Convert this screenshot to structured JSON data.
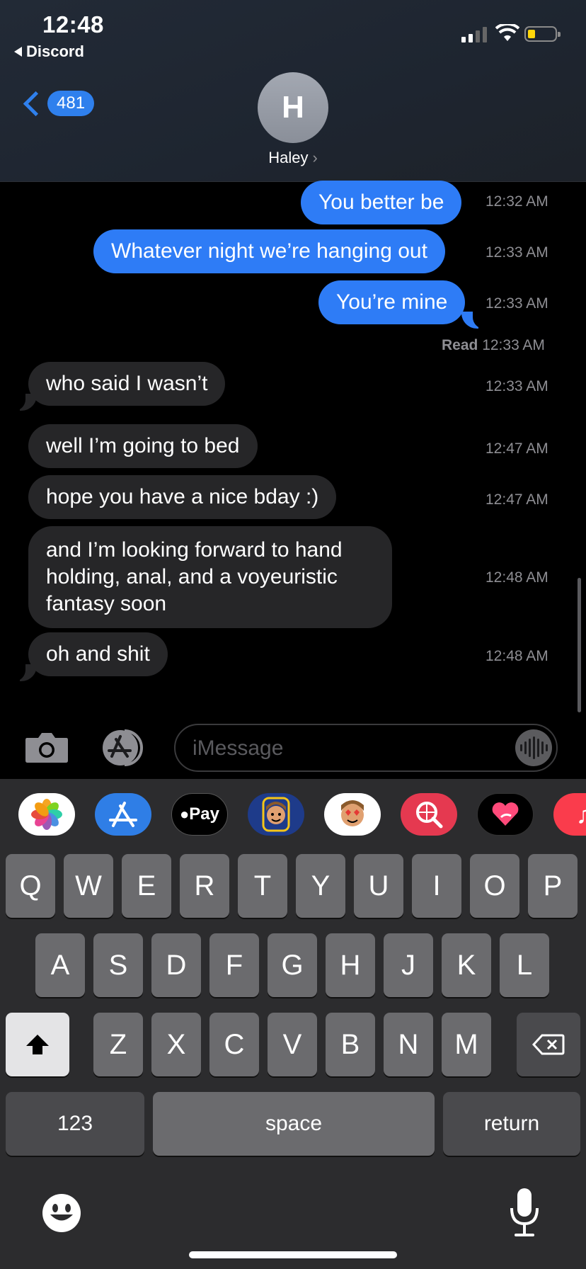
{
  "status_bar": {
    "time": "12:48",
    "back_app": "Discord",
    "battery_color": "#ffd60a"
  },
  "header": {
    "back_count": "481",
    "avatar_initial": "H",
    "contact_name": "Haley",
    "accent": "#2f80ed"
  },
  "messages": [
    {
      "text": "You better be",
      "time": "12:32 AM",
      "direction": "sent"
    },
    {
      "text": "Whatever night we’re hanging out",
      "time": "12:33 AM",
      "direction": "sent"
    },
    {
      "text": "You’re mine",
      "time": "12:33 AM",
      "direction": "sent"
    },
    {
      "text": "who said I wasn’t",
      "time": "12:33 AM",
      "direction": "received"
    },
    {
      "text": "well I’m going to bed",
      "time": "12:47 AM",
      "direction": "received"
    },
    {
      "text": "hope you have a nice bday :)",
      "time": "12:47 AM",
      "direction": "received"
    },
    {
      "lines": [
        "and I’m looking forward to hand",
        "holding, anal, and a voyeuristic",
        "fantasy soon"
      ],
      "time": "12:48 AM",
      "direction": "received"
    },
    {
      "text": "oh and shit",
      "time": "12:48 AM",
      "direction": "received"
    }
  ],
  "read_receipt": {
    "label": "Read",
    "time": "12:33 AM"
  },
  "input": {
    "placeholder": "iMessage"
  },
  "app_strip": [
    "photos-icon",
    "app-store-icon",
    "apple-pay-icon",
    "memoji-icon",
    "memoji-stickers-icon",
    "web-search-icon",
    "digital-touch-icon",
    "music-icon"
  ],
  "apple_pay_label": "Pay",
  "keyboard": {
    "row1": [
      "Q",
      "W",
      "E",
      "R",
      "T",
      "Y",
      "U",
      "I",
      "O",
      "P"
    ],
    "row2": [
      "A",
      "S",
      "D",
      "F",
      "G",
      "H",
      "J",
      "K",
      "L"
    ],
    "row3": [
      "Z",
      "X",
      "C",
      "V",
      "B",
      "N",
      "M"
    ],
    "numbers": "123",
    "space": "space",
    "return": "return"
  }
}
